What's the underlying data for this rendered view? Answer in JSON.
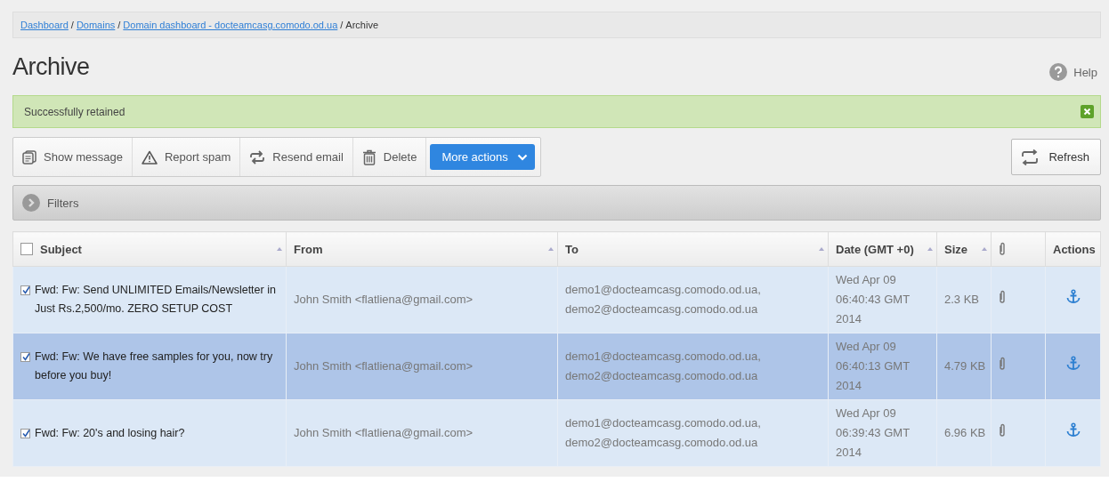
{
  "breadcrumb_separator": "/",
  "breadcrumb": [
    {
      "label": "Dashboard",
      "kind": "link"
    },
    {
      "label": "Domains",
      "kind": "link"
    },
    {
      "label": "Domain dashboard - docteamcasg.comodo.od.ua",
      "kind": "link"
    },
    {
      "label": "Archive",
      "kind": "current"
    }
  ],
  "title": "Archive",
  "help": "Help",
  "alert": {
    "message": "Successfully retained"
  },
  "toolbar": [
    {
      "label": "Show message",
      "kind": "show"
    },
    {
      "label": "Report spam",
      "kind": "report"
    },
    {
      "label": "Resend email",
      "kind": "resend"
    },
    {
      "label": "Delete",
      "kind": "delete"
    },
    {
      "label": "More actions",
      "kind": "menu"
    }
  ],
  "refresh": "Refresh",
  "filters": {
    "label": "Filters",
    "expanded": false
  },
  "table": {
    "all_checked": false,
    "columns": [
      {
        "label": "Subject",
        "kind": "check",
        "sortable": true
      },
      {
        "label": "From",
        "kind": "text",
        "sortable": true
      },
      {
        "label": "To",
        "kind": "text",
        "sortable": true
      },
      {
        "label": "Date (GMT +0)",
        "kind": "text",
        "sortable": true
      },
      {
        "label": "Size",
        "kind": "text",
        "sortable": true
      },
      {
        "kind": "attachment",
        "sortable": false
      },
      {
        "label": "Actions",
        "kind": "text",
        "sortable": false
      }
    ],
    "rows": [
      {
        "checked": true,
        "selected": false,
        "subject": "Fwd: Fw: Send UNLIMITED Emails/Newsletter in Just Rs.2,500/mo. ZERO SETUP COST",
        "from": "John Smith <flatliena@gmail.com>",
        "to": "demo1@docteamcasg.comodo.od.ua, demo2@docteamcasg.comodo.od.ua",
        "date": "Wed Apr 09 06:40:43 GMT 2014",
        "size": "2.3 KB",
        "attachment": true
      },
      {
        "checked": true,
        "selected": true,
        "subject": "Fwd: Fw: We have free samples for you, now try before you buy!",
        "from": "John Smith <flatliena@gmail.com>",
        "to": "demo1@docteamcasg.comodo.od.ua, demo2@docteamcasg.comodo.od.ua",
        "date": "Wed Apr 09 06:40:13 GMT 2014",
        "size": "4.79 KB",
        "attachment": true
      },
      {
        "checked": true,
        "selected": false,
        "subject": "Fwd: Fw: 20's and losing hair?",
        "from": "John Smith <flatliena@gmail.com>",
        "to": "demo1@docteamcasg.comodo.od.ua, demo2@docteamcasg.comodo.od.ua",
        "date": "Wed Apr 09 06:39:43 GMT 2014",
        "size": "6.96 KB",
        "attachment": true
      }
    ]
  }
}
